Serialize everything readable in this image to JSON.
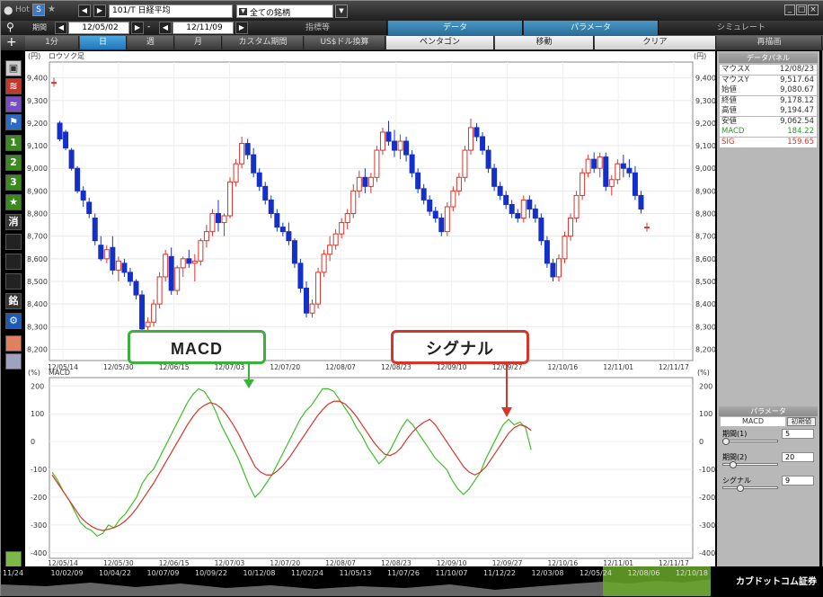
{
  "toolbar": {
    "hot": "Hot",
    "symbol": "101/T 日経平均",
    "market": "全ての銘柄",
    "period_label": "期間",
    "date_from": "12/05/02",
    "date_to": "12/11/09",
    "dash": "-"
  },
  "segments": {
    "indicator": "指標等",
    "data": "データ",
    "parameter": "パラメータ",
    "simulate": "シミュレート"
  },
  "tabs": [
    "1分",
    "日",
    "週",
    "月",
    "カスタム期間",
    "US$ドル換算",
    "ペンタゴン",
    "移動",
    "クリア",
    "再描画"
  ],
  "chart": {
    "upper_title": "ロウソク足",
    "lower_title": "MACD",
    "unit_left": "(円)",
    "unit_right": "(円)",
    "unit_pct": "(%)"
  },
  "panel": {
    "data_title": "データパネル",
    "rows": [
      {
        "k": "マウスX",
        "v": "12/08/23"
      },
      {
        "k": "マウスY",
        "v": "9,517.64"
      },
      {
        "k": "始値",
        "v": "9,080.67"
      },
      {
        "k": "終値",
        "v": "9,178.12"
      },
      {
        "k": "高値",
        "v": "9,194.47"
      },
      {
        "k": "安値",
        "v": "9,062.54"
      },
      {
        "k": "MACD",
        "v": "184.22"
      },
      {
        "k": "SIG",
        "v": "159.65"
      }
    ],
    "param_title": "パラメータ",
    "param_hdr": "MACD",
    "param_reset": "初期値",
    "params": [
      {
        "k": "期間(1)",
        "v": "5"
      },
      {
        "k": "期間(2)",
        "v": "20"
      },
      {
        "k": "シグナル",
        "v": "9"
      }
    ]
  },
  "callouts": {
    "macd": "MACD",
    "signal": "シグナル"
  },
  "left_icons": [
    "1",
    "2",
    "3"
  ],
  "bottom": {
    "labels": [
      "11/24",
      "10/02/09",
      "10/04/22",
      "10/07/09",
      "10/09/22",
      "10/12/08",
      "11/02/24",
      "11/05/13",
      "11/07/26",
      "11/10/07",
      "11/12/22",
      "12/03/08",
      "12/05/24",
      "12/08/06",
      "12/10/18"
    ],
    "brand": "カブドットコム証券"
  },
  "colors": {
    "up": "#d8352a",
    "down": "#1530c8",
    "macd": "#3fbf2a",
    "signal": "#d8352a"
  },
  "chart_data": {
    "type": "line",
    "x_ticks": [
      "12/05/14",
      "12/05/30",
      "12/06/15",
      "12/07/03",
      "12/07/20",
      "12/08/07",
      "12/08/23",
      "12/09/10",
      "12/09/27",
      "12/10/16",
      "12/11/01",
      "12/11/17"
    ],
    "price_yticks": [
      9400,
      9300,
      9200,
      9100,
      9000,
      8900,
      8800,
      8700,
      8600,
      8500,
      8400,
      8300,
      8200
    ],
    "price_ylim": [
      8150,
      9470
    ],
    "macd_yticks": [
      200,
      100,
      0,
      -100,
      -200,
      -300,
      -400
    ],
    "macd_ylim": [
      -420,
      230
    ],
    "candles": [
      [
        9380,
        9400,
        9360,
        9380
      ],
      [
        9200,
        9210,
        9120,
        9130
      ],
      [
        9160,
        9170,
        9080,
        9090
      ],
      [
        9080,
        9090,
        8990,
        9000
      ],
      [
        9000,
        9010,
        8890,
        8900
      ],
      [
        8900,
        8920,
        8830,
        8860
      ],
      [
        8850,
        8870,
        8780,
        8800
      ],
      [
        8780,
        8800,
        8660,
        8680
      ],
      [
        8660,
        8700,
        8590,
        8600
      ],
      [
        8600,
        8660,
        8580,
        8640
      ],
      [
        8650,
        8700,
        8530,
        8550
      ],
      [
        8550,
        8610,
        8500,
        8590
      ],
      [
        8580,
        8600,
        8520,
        8540
      ],
      [
        8540,
        8560,
        8480,
        8500
      ],
      [
        8500,
        8510,
        8420,
        8440
      ],
      [
        8440,
        8460,
        8260,
        8290
      ],
      [
        8300,
        8340,
        8280,
        8320
      ],
      [
        8320,
        8420,
        8300,
        8400
      ],
      [
        8400,
        8540,
        8380,
        8520
      ],
      [
        8520,
        8640,
        8500,
        8620
      ],
      [
        8610,
        8650,
        8440,
        8460
      ],
      [
        8460,
        8570,
        8440,
        8560
      ],
      [
        8560,
        8610,
        8520,
        8600
      ],
      [
        8600,
        8640,
        8560,
        8580
      ],
      [
        8580,
        8620,
        8500,
        8590
      ],
      [
        8590,
        8690,
        8570,
        8680
      ],
      [
        8680,
        8750,
        8650,
        8720
      ],
      [
        8720,
        8820,
        8700,
        8800
      ],
      [
        8800,
        8860,
        8720,
        8760
      ],
      [
        8760,
        8800,
        8700,
        8790
      ],
      [
        8790,
        8960,
        8780,
        8940
      ],
      [
        8940,
        9040,
        8920,
        9020
      ],
      [
        9020,
        9140,
        9000,
        9110
      ],
      [
        9110,
        9130,
        9040,
        9060
      ],
      [
        9060,
        9090,
        8960,
        8980
      ],
      [
        8980,
        9000,
        8900,
        8920
      ],
      [
        8920,
        8940,
        8840,
        8860
      ],
      [
        8860,
        8880,
        8780,
        8800
      ],
      [
        8800,
        8820,
        8720,
        8740
      ],
      [
        8740,
        8760,
        8700,
        8720
      ],
      [
        8720,
        8760,
        8660,
        8680
      ],
      [
        8680,
        8690,
        8560,
        8580
      ],
      [
        8580,
        8600,
        8450,
        8470
      ],
      [
        8470,
        8500,
        8340,
        8360
      ],
      [
        8360,
        8420,
        8340,
        8400
      ],
      [
        8400,
        8560,
        8380,
        8540
      ],
      [
        8540,
        8640,
        8520,
        8620
      ],
      [
        8620,
        8700,
        8590,
        8660
      ],
      [
        8660,
        8730,
        8640,
        8710
      ],
      [
        8710,
        8780,
        8690,
        8760
      ],
      [
        8760,
        8820,
        8730,
        8800
      ],
      [
        8800,
        8930,
        8780,
        8900
      ],
      [
        8900,
        8990,
        8870,
        8960
      ],
      [
        8960,
        9000,
        8890,
        8920
      ],
      [
        8920,
        8980,
        8890,
        8960
      ],
      [
        8960,
        9100,
        8940,
        9080
      ],
      [
        9080,
        9180,
        9060,
        9160
      ],
      [
        9160,
        9210,
        9100,
        9120
      ],
      [
        9120,
        9170,
        9050,
        9080
      ],
      [
        9080,
        9150,
        9040,
        9120
      ],
      [
        9120,
        9140,
        9030,
        9060
      ],
      [
        9060,
        9080,
        8960,
        8980
      ],
      [
        8980,
        9000,
        8890,
        8910
      ],
      [
        8910,
        8930,
        8840,
        8860
      ],
      [
        8860,
        8880,
        8790,
        8810
      ],
      [
        8810,
        8830,
        8760,
        8780
      ],
      [
        8780,
        8800,
        8700,
        8720
      ],
      [
        8720,
        8850,
        8700,
        8830
      ],
      [
        8830,
        8920,
        8810,
        8900
      ],
      [
        8900,
        8980,
        8880,
        8960
      ],
      [
        8960,
        9100,
        8940,
        9080
      ],
      [
        9080,
        9220,
        9060,
        9180
      ],
      [
        9180,
        9200,
        9120,
        9140
      ],
      [
        9140,
        9160,
        9060,
        9080
      ],
      [
        9080,
        9100,
        8980,
        9000
      ],
      [
        9000,
        9020,
        8900,
        8920
      ],
      [
        8920,
        8940,
        8860,
        8880
      ],
      [
        8880,
        8900,
        8820,
        8840
      ],
      [
        8840,
        8860,
        8780,
        8800
      ],
      [
        8800,
        8820,
        8760,
        8780
      ],
      [
        8780,
        8880,
        8760,
        8860
      ],
      [
        8860,
        8880,
        8780,
        8820
      ],
      [
        8820,
        8840,
        8760,
        8780
      ],
      [
        8780,
        8800,
        8660,
        8680
      ],
      [
        8680,
        8700,
        8560,
        8580
      ],
      [
        8580,
        8600,
        8500,
        8520
      ],
      [
        8520,
        8620,
        8500,
        8600
      ],
      [
        8600,
        8720,
        8580,
        8700
      ],
      [
        8700,
        8800,
        8680,
        8780
      ],
      [
        8780,
        8900,
        8760,
        8880
      ],
      [
        8880,
        9000,
        8860,
        8980
      ],
      [
        8980,
        9060,
        8960,
        9040
      ],
      [
        9040,
        9070,
        8980,
        9000
      ],
      [
        9000,
        9070,
        8960,
        9050
      ],
      [
        9050,
        9070,
        8900,
        8920
      ],
      [
        8920,
        8970,
        8880,
        8950
      ],
      [
        8950,
        9040,
        8930,
        9020
      ],
      [
        9020,
        9060,
        8960,
        9000
      ],
      [
        9000,
        9040,
        8960,
        8980
      ],
      [
        8980,
        9010,
        8860,
        8880
      ],
      [
        8880,
        8900,
        8800,
        8820
      ],
      [
        8740,
        8760,
        8720,
        8740
      ]
    ],
    "macd_x": [
      0,
      6,
      12,
      18,
      24,
      30,
      36,
      42,
      48,
      54,
      60,
      66,
      72,
      78,
      84,
      90,
      96,
      102,
      108,
      114,
      120,
      126,
      132,
      138,
      144,
      150,
      156,
      162,
      168,
      174,
      180,
      186,
      192,
      198,
      204,
      210,
      216,
      222,
      228,
      234,
      240,
      246,
      252,
      258,
      264,
      270,
      276,
      282,
      288,
      294,
      300,
      306,
      312,
      318,
      324,
      330,
      336,
      342,
      348,
      354,
      360,
      366,
      372,
      378,
      384,
      390,
      396,
      402,
      408,
      414,
      420,
      426,
      432,
      438,
      444,
      450,
      456,
      462,
      468,
      474,
      480,
      486,
      492,
      498,
      504,
      510,
      516,
      522,
      528,
      534,
      540,
      546,
      552,
      558,
      564,
      570,
      576,
      582,
      588,
      594,
      600,
      606,
      612,
      618,
      624,
      630,
      636,
      642,
      648,
      654,
      660
    ],
    "series": [
      {
        "name": "MACD",
        "values": [
          -110,
          -140,
          -180,
          -210,
          -250,
          -290,
          -310,
          -320,
          -340,
          -330,
          -300,
          -310,
          -280,
          -260,
          -230,
          -200,
          -150,
          -120,
          -100,
          -60,
          -20,
          20,
          60,
          100,
          140,
          170,
          190,
          180,
          150,
          110,
          60,
          20,
          -20,
          -60,
          -110,
          -160,
          -200,
          -180,
          -150,
          -120,
          -80,
          -40,
          0,
          40,
          80,
          110,
          130,
          160,
          190,
          190,
          180,
          150,
          120,
          90,
          50,
          20,
          -20,
          -50,
          -80,
          -60,
          -30,
          10,
          50,
          80,
          60,
          30,
          0,
          -30,
          -60,
          -80,
          -100,
          -140,
          -170,
          -190,
          -170,
          -140,
          -110,
          -60,
          -20,
          20,
          60,
          80,
          60,
          70,
          50,
          -30
        ]
      },
      {
        "name": "SIG",
        "values": [
          -120,
          -150,
          -180,
          -210,
          -240,
          -270,
          -290,
          -305,
          -315,
          -320,
          -315,
          -310,
          -300,
          -285,
          -265,
          -240,
          -210,
          -180,
          -150,
          -115,
          -80,
          -45,
          -10,
          25,
          60,
          90,
          115,
          130,
          140,
          135,
          120,
          95,
          65,
          30,
          -10,
          -50,
          -90,
          -110,
          -120,
          -120,
          -105,
          -85,
          -60,
          -30,
          0,
          30,
          60,
          90,
          115,
          135,
          145,
          145,
          135,
          115,
          90,
          60,
          30,
          0,
          -25,
          -45,
          -50,
          -40,
          -20,
          10,
          35,
          55,
          70,
          80,
          60,
          30,
          0,
          -30,
          -60,
          -90,
          -110,
          -120,
          -110,
          -90,
          -60,
          -30,
          0,
          30,
          50,
          60,
          55,
          40
        ]
      }
    ]
  }
}
